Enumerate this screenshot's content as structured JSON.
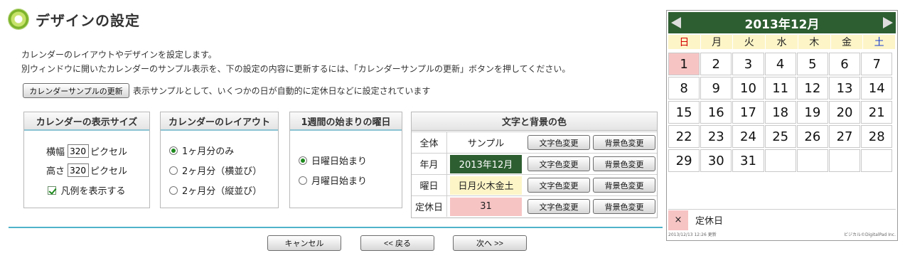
{
  "page": {
    "title": "デザインの設定",
    "desc_line1": "カレンダーのレイアウトやデザインを設定します。",
    "desc_line2": "別ウィンドウに開いたカレンダーのサンプル表示を、下の設定の内容に更新するには、「カレンダーサンプルの更新」ボタンを押してください。",
    "sample_button": "カレンダーサンプルの更新",
    "sample_note": "表示サンプルとして、いくつかの日が自動的に定休日などに設定されています"
  },
  "size_panel": {
    "header": "カレンダーの表示サイズ",
    "width_label": "横幅",
    "width_value": "320",
    "height_label": "高さ",
    "height_value": "320",
    "unit": "ピクセル",
    "legend_checkbox": "凡例を表示する",
    "legend_checked": true
  },
  "layout_panel": {
    "header": "カレンダーのレイアウト",
    "options": [
      "1ヶ月分のみ",
      "2ヶ月分（横並び）",
      "2ヶ月分（縦並び）"
    ],
    "selected": 0
  },
  "weekstart_panel": {
    "header": "1週間の始まりの曜日",
    "options": [
      "日曜日始まり",
      "月曜日始まり"
    ],
    "selected": 0
  },
  "color_panel": {
    "header": "文字と背景の色",
    "text_button": "文字色変更",
    "bg_button": "背景色変更",
    "rows": [
      {
        "label": "全体",
        "sample": "サンプル",
        "bg": "#ffffff",
        "fg": "#222222"
      },
      {
        "label": "年月",
        "sample": "2013年12月",
        "bg": "#2d5e31",
        "fg": "#ffffff"
      },
      {
        "label": "曜日",
        "sample": "日月火木金土",
        "bg": "#fdf5c7",
        "fg": "#222222"
      },
      {
        "label": "定休日",
        "sample": "31",
        "bg": "#f7c4c4",
        "fg": "#222222"
      }
    ]
  },
  "footer": {
    "cancel": "キャンセル",
    "back": "<< 戻る",
    "next": "次へ >>"
  },
  "calendar": {
    "month_title": "2013年12月",
    "weekdays": [
      "日",
      "月",
      "火",
      "水",
      "木",
      "金",
      "土"
    ],
    "weekday_colors": [
      "#d40000",
      "#222222",
      "#222222",
      "#222222",
      "#222222",
      "#222222",
      "#1c3fd1"
    ],
    "weeks": [
      [
        "1",
        "2",
        "3",
        "4",
        "5",
        "6",
        "7"
      ],
      [
        "8",
        "9",
        "10",
        "11",
        "12",
        "13",
        "14"
      ],
      [
        "15",
        "16",
        "17",
        "18",
        "19",
        "20",
        "21"
      ],
      [
        "22",
        "23",
        "24",
        "25",
        "26",
        "27",
        "28"
      ],
      [
        "29",
        "30",
        "31",
        "",
        "",
        "",
        ""
      ]
    ],
    "holiday_days": [
      "1"
    ],
    "legend_mark": "×",
    "legend_label": "定休日",
    "updated": "2013/12/13 12:26 更新",
    "credit": "ビジカル©DigitalPad Inc."
  }
}
